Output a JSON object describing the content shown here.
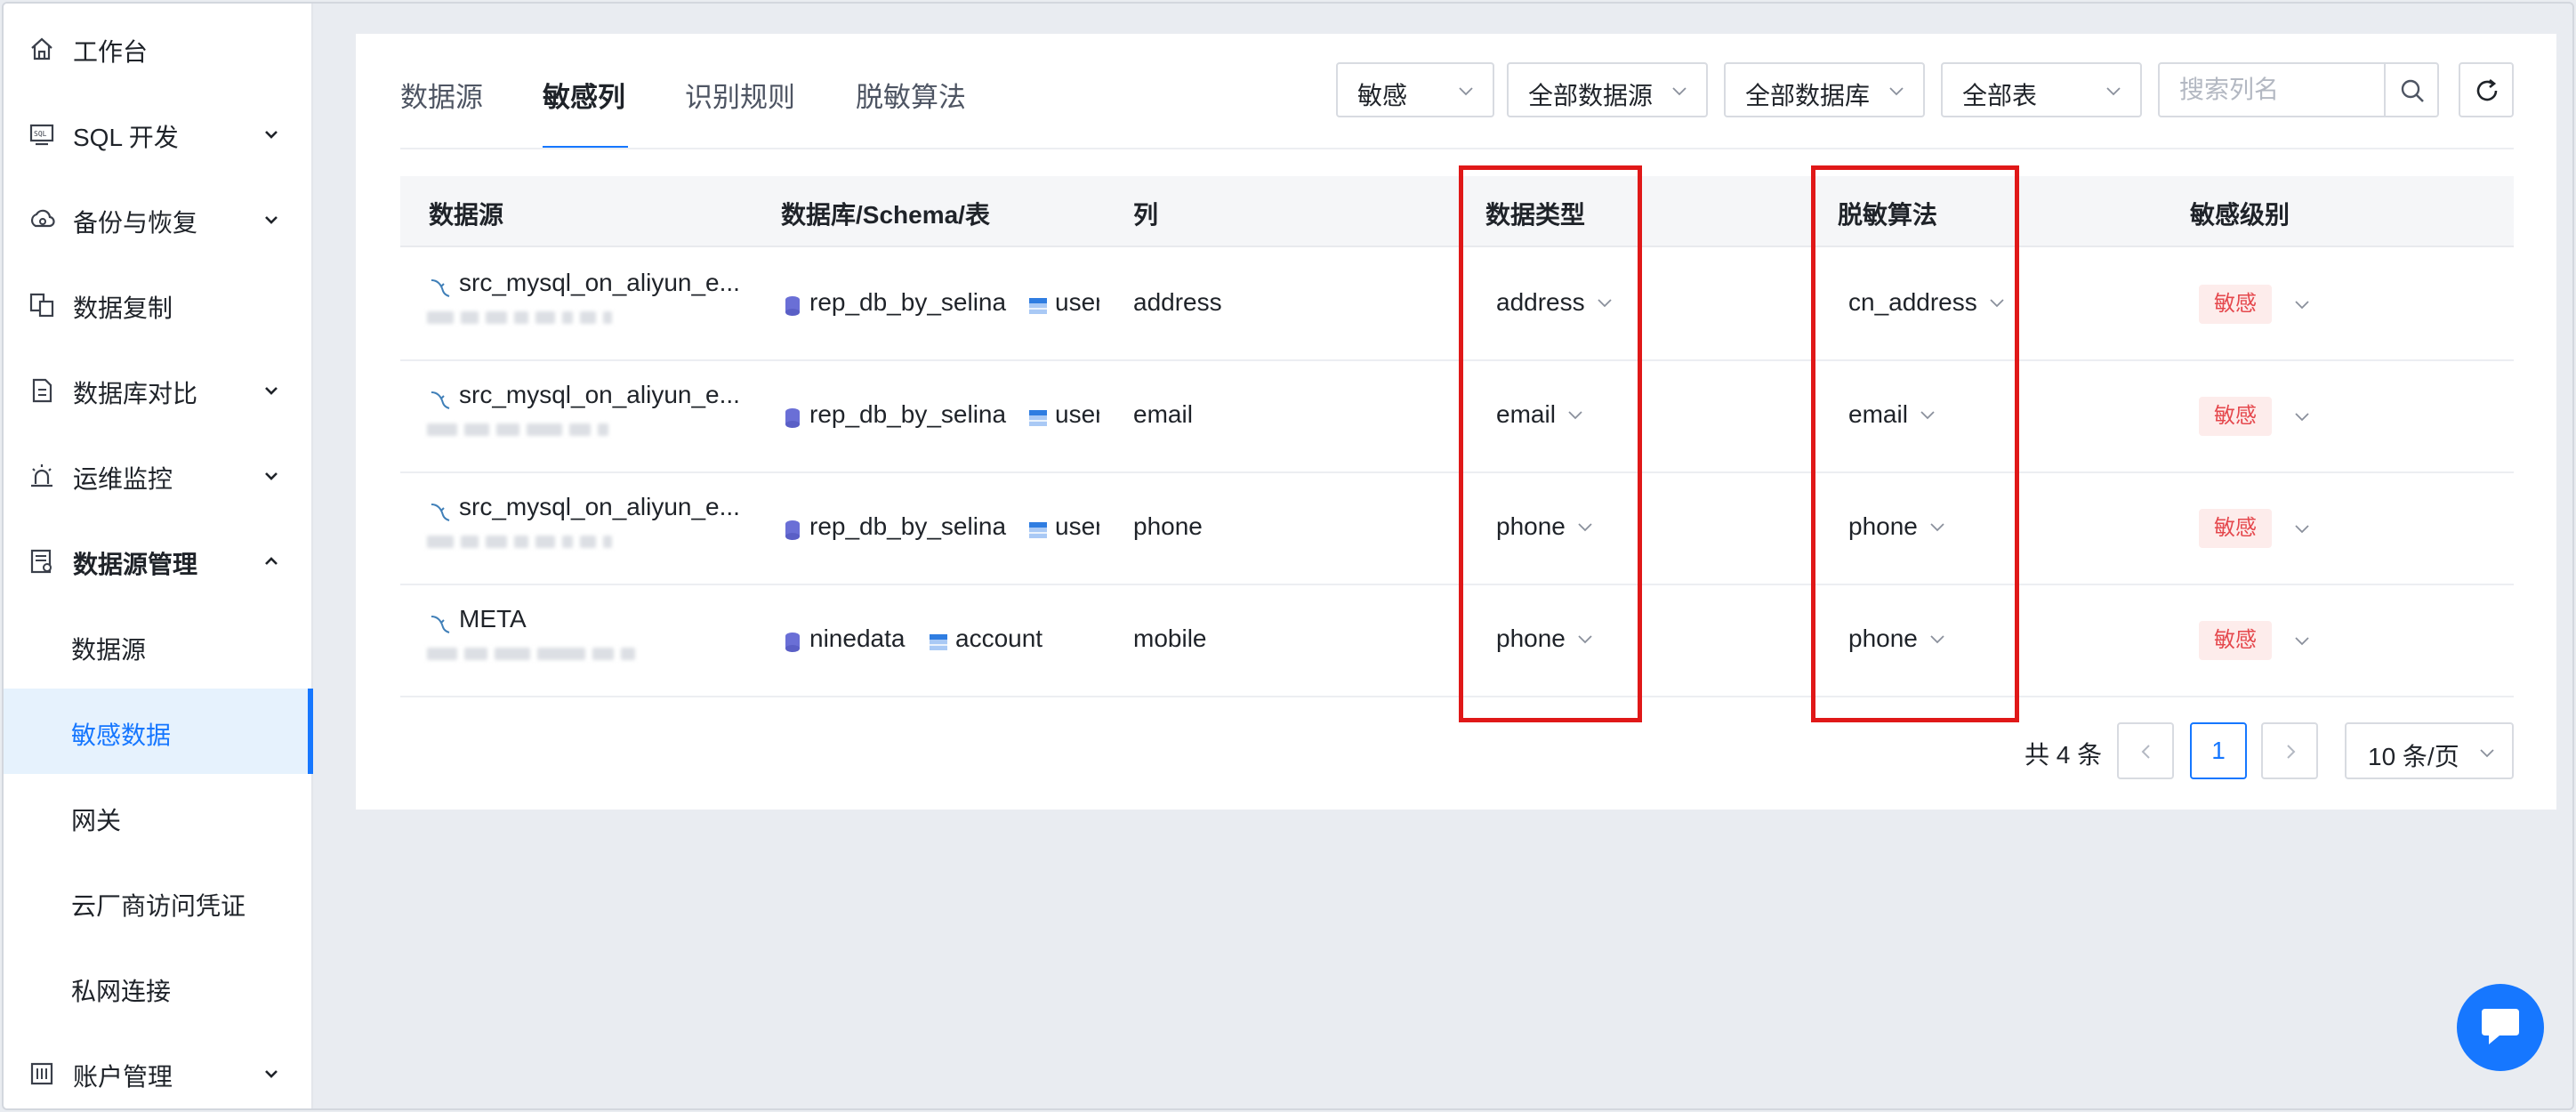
{
  "sidebar": {
    "items": [
      {
        "label": "工作台",
        "icon": "home-icon",
        "expandable": false
      },
      {
        "label": "SQL 开发",
        "icon": "sql-dev-icon",
        "expandable": true
      },
      {
        "label": "备份与恢复",
        "icon": "backup-icon",
        "expandable": true
      },
      {
        "label": "数据复制",
        "icon": "replication-icon",
        "expandable": false
      },
      {
        "label": "数据库对比",
        "icon": "compare-icon",
        "expandable": true
      },
      {
        "label": "运维监控",
        "icon": "monitor-icon",
        "expandable": true
      },
      {
        "label": "数据源管理",
        "icon": "datasource-manage-icon",
        "expandable": true,
        "expanded": true
      }
    ],
    "sub_items": [
      {
        "label": "数据源"
      },
      {
        "label": "敏感数据",
        "active": true
      },
      {
        "label": "网关"
      },
      {
        "label": "云厂商访问凭证"
      },
      {
        "label": "私网连接"
      }
    ],
    "account": {
      "label": "账户管理",
      "icon": "account-icon"
    }
  },
  "tabs": [
    {
      "label": "数据源"
    },
    {
      "label": "敏感列",
      "active": true
    },
    {
      "label": "识别规则"
    },
    {
      "label": "脱敏算法"
    }
  ],
  "filters": {
    "sensitivity": "敏感",
    "datasource": "全部数据源",
    "database": "全部数据库",
    "table": "全部表",
    "search_placeholder": "搜索列名"
  },
  "table": {
    "headers": [
      "数据源",
      "数据库/Schema/表",
      "列",
      "数据类型",
      "脱敏算法",
      "敏感级别"
    ],
    "rows": [
      {
        "datasource": "src_mysql_on_aliyun_e...",
        "database": "rep_db_by_selina",
        "table": "user",
        "column": "address",
        "data_type": "address",
        "algorithm": "cn_address",
        "level": "敏感"
      },
      {
        "datasource": "src_mysql_on_aliyun_e...",
        "database": "rep_db_by_selina",
        "table": "user",
        "column": "email",
        "data_type": "email",
        "algorithm": "email",
        "level": "敏感"
      },
      {
        "datasource": "src_mysql_on_aliyun_e...",
        "database": "rep_db_by_selina",
        "table": "user",
        "column": "phone",
        "data_type": "phone",
        "algorithm": "phone",
        "level": "敏感"
      },
      {
        "datasource": "META",
        "database": "ninedata",
        "table": "account",
        "column": "mobile",
        "data_type": "phone",
        "algorithm": "phone",
        "level": "敏感"
      }
    ]
  },
  "pagination": {
    "total": "共 4 条",
    "current_page": "1",
    "page_size": "10 条/页"
  },
  "colors": {
    "accent": "#1677ff",
    "highlight_box": "#e01818",
    "badge_text": "#e5484d",
    "badge_bg": "#fdeceb"
  }
}
